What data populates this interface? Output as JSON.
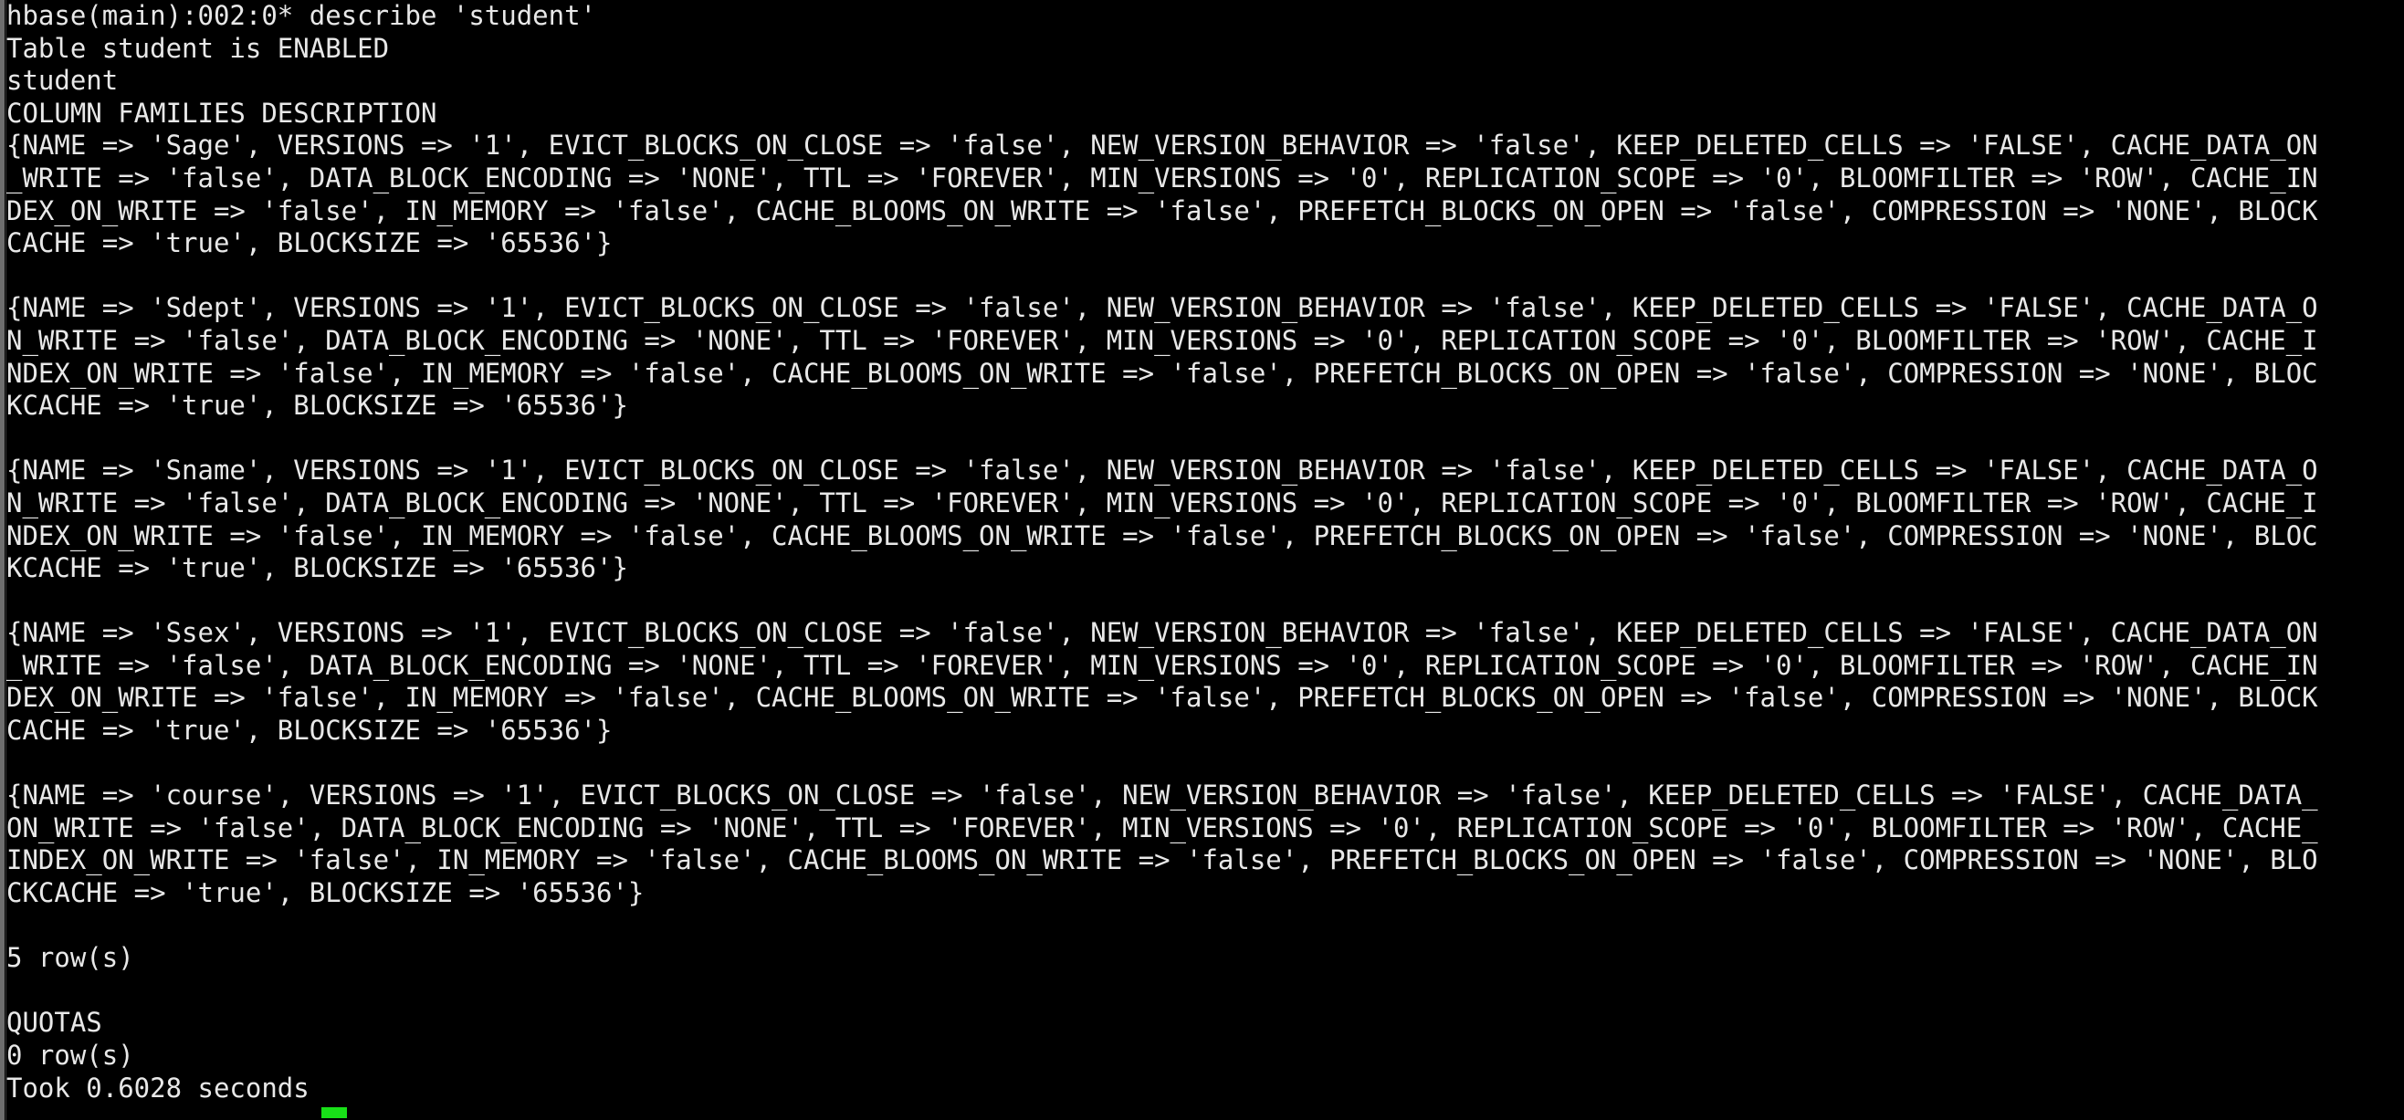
{
  "terminal": {
    "app": "hbase-shell",
    "background_color": "#000000",
    "foreground_color": "#e8e8e8",
    "cursor_color": "#18e018",
    "scrollbar_color": "#6e6e6e",
    "prompt": "hbase(main):002:0*",
    "command": "describe 'student'",
    "lines": [
      "hbase(main):002:0* describe 'student'",
      "Table student is ENABLED",
      "student",
      "COLUMN FAMILIES DESCRIPTION",
      "{NAME => 'Sage', VERSIONS => '1', EVICT_BLOCKS_ON_CLOSE => 'false', NEW_VERSION_BEHAVIOR => 'false', KEEP_DELETED_CELLS => 'FALSE', CACHE_DATA_ON",
      "_WRITE => 'false', DATA_BLOCK_ENCODING => 'NONE', TTL => 'FOREVER', MIN_VERSIONS => '0', REPLICATION_SCOPE => '0', BLOOMFILTER => 'ROW', CACHE_IN",
      "DEX_ON_WRITE => 'false', IN_MEMORY => 'false', CACHE_BLOOMS_ON_WRITE => 'false', PREFETCH_BLOCKS_ON_OPEN => 'false', COMPRESSION => 'NONE', BLOCK",
      "CACHE => 'true', BLOCKSIZE => '65536'}",
      "",
      "{NAME => 'Sdept', VERSIONS => '1', EVICT_BLOCKS_ON_CLOSE => 'false', NEW_VERSION_BEHAVIOR => 'false', KEEP_DELETED_CELLS => 'FALSE', CACHE_DATA_O",
      "N_WRITE => 'false', DATA_BLOCK_ENCODING => 'NONE', TTL => 'FOREVER', MIN_VERSIONS => '0', REPLICATION_SCOPE => '0', BLOOMFILTER => 'ROW', CACHE_I",
      "NDEX_ON_WRITE => 'false', IN_MEMORY => 'false', CACHE_BLOOMS_ON_WRITE => 'false', PREFETCH_BLOCKS_ON_OPEN => 'false', COMPRESSION => 'NONE', BLOC",
      "KCACHE => 'true', BLOCKSIZE => '65536'}",
      "",
      "{NAME => 'Sname', VERSIONS => '1', EVICT_BLOCKS_ON_CLOSE => 'false', NEW_VERSION_BEHAVIOR => 'false', KEEP_DELETED_CELLS => 'FALSE', CACHE_DATA_O",
      "N_WRITE => 'false', DATA_BLOCK_ENCODING => 'NONE', TTL => 'FOREVER', MIN_VERSIONS => '0', REPLICATION_SCOPE => '0', BLOOMFILTER => 'ROW', CACHE_I",
      "NDEX_ON_WRITE => 'false', IN_MEMORY => 'false', CACHE_BLOOMS_ON_WRITE => 'false', PREFETCH_BLOCKS_ON_OPEN => 'false', COMPRESSION => 'NONE', BLOC",
      "KCACHE => 'true', BLOCKSIZE => '65536'}",
      "",
      "{NAME => 'Ssex', VERSIONS => '1', EVICT_BLOCKS_ON_CLOSE => 'false', NEW_VERSION_BEHAVIOR => 'false', KEEP_DELETED_CELLS => 'FALSE', CACHE_DATA_ON",
      "_WRITE => 'false', DATA_BLOCK_ENCODING => 'NONE', TTL => 'FOREVER', MIN_VERSIONS => '0', REPLICATION_SCOPE => '0', BLOOMFILTER => 'ROW', CACHE_IN",
      "DEX_ON_WRITE => 'false', IN_MEMORY => 'false', CACHE_BLOOMS_ON_WRITE => 'false', PREFETCH_BLOCKS_ON_OPEN => 'false', COMPRESSION => 'NONE', BLOCK",
      "CACHE => 'true', BLOCKSIZE => '65536'}",
      "",
      "{NAME => 'course', VERSIONS => '1', EVICT_BLOCKS_ON_CLOSE => 'false', NEW_VERSION_BEHAVIOR => 'false', KEEP_DELETED_CELLS => 'FALSE', CACHE_DATA_",
      "ON_WRITE => 'false', DATA_BLOCK_ENCODING => 'NONE', TTL => 'FOREVER', MIN_VERSIONS => '0', REPLICATION_SCOPE => '0', BLOOMFILTER => 'ROW', CACHE_",
      "INDEX_ON_WRITE => 'false', IN_MEMORY => 'false', CACHE_BLOOMS_ON_WRITE => 'false', PREFETCH_BLOCKS_ON_OPEN => 'false', COMPRESSION => 'NONE', BLO",
      "CKCACHE => 'true', BLOCKSIZE => '65536'}",
      "",
      "5 row(s)",
      "",
      "QUOTAS",
      "0 row(s)",
      "Took 0.6028 seconds"
    ],
    "table_name": "student",
    "table_status": "ENABLED",
    "section_headers": [
      "COLUMN FAMILIES DESCRIPTION",
      "QUOTAS"
    ],
    "column_families": [
      {
        "NAME": "Sage",
        "VERSIONS": "1",
        "EVICT_BLOCKS_ON_CLOSE": "false",
        "NEW_VERSION_BEHAVIOR": "false",
        "KEEP_DELETED_CELLS": "FALSE",
        "CACHE_DATA_ON_WRITE": "false",
        "DATA_BLOCK_ENCODING": "NONE",
        "TTL": "FOREVER",
        "MIN_VERSIONS": "0",
        "REPLICATION_SCOPE": "0",
        "BLOOMFILTER": "ROW",
        "CACHE_INDEX_ON_WRITE": "false",
        "IN_MEMORY": "false",
        "CACHE_BLOOMS_ON_WRITE": "false",
        "PREFETCH_BLOCKS_ON_OPEN": "false",
        "COMPRESSION": "NONE",
        "BLOCKCACHE": "true",
        "BLOCKSIZE": "65536"
      },
      {
        "NAME": "Sdept",
        "VERSIONS": "1",
        "EVICT_BLOCKS_ON_CLOSE": "false",
        "NEW_VERSION_BEHAVIOR": "false",
        "KEEP_DELETED_CELLS": "FALSE",
        "CACHE_DATA_ON_WRITE": "false",
        "DATA_BLOCK_ENCODING": "NONE",
        "TTL": "FOREVER",
        "MIN_VERSIONS": "0",
        "REPLICATION_SCOPE": "0",
        "BLOOMFILTER": "ROW",
        "CACHE_INDEX_ON_WRITE": "false",
        "IN_MEMORY": "false",
        "CACHE_BLOOMS_ON_WRITE": "false",
        "PREFETCH_BLOCKS_ON_OPEN": "false",
        "COMPRESSION": "NONE",
        "BLOCKCACHE": "true",
        "BLOCKSIZE": "65536"
      },
      {
        "NAME": "Sname",
        "VERSIONS": "1",
        "EVICT_BLOCKS_ON_CLOSE": "false",
        "NEW_VERSION_BEHAVIOR": "false",
        "KEEP_DELETED_CELLS": "FALSE",
        "CACHE_DATA_ON_WRITE": "false",
        "DATA_BLOCK_ENCODING": "NONE",
        "TTL": "FOREVER",
        "MIN_VERSIONS": "0",
        "REPLICATION_SCOPE": "0",
        "BLOOMFILTER": "ROW",
        "CACHE_INDEX_ON_WRITE": "false",
        "IN_MEMORY": "false",
        "CACHE_BLOOMS_ON_WRITE": "false",
        "PREFETCH_BLOCKS_ON_OPEN": "false",
        "COMPRESSION": "NONE",
        "BLOCKCACHE": "true",
        "BLOCKSIZE": "65536"
      },
      {
        "NAME": "Ssex",
        "VERSIONS": "1",
        "EVICT_BLOCKS_ON_CLOSE": "false",
        "NEW_VERSION_BEHAVIOR": "false",
        "KEEP_DELETED_CELLS": "FALSE",
        "CACHE_DATA_ON_WRITE": "false",
        "DATA_BLOCK_ENCODING": "NONE",
        "TTL": "FOREVER",
        "MIN_VERSIONS": "0",
        "REPLICATION_SCOPE": "0",
        "BLOOMFILTER": "ROW",
        "CACHE_INDEX_ON_WRITE": "false",
        "IN_MEMORY": "false",
        "CACHE_BLOOMS_ON_WRITE": "false",
        "PREFETCH_BLOCKS_ON_OPEN": "false",
        "COMPRESSION": "NONE",
        "BLOCKCACHE": "true",
        "BLOCKSIZE": "65536"
      },
      {
        "NAME": "course",
        "VERSIONS": "1",
        "EVICT_BLOCKS_ON_CLOSE": "false",
        "NEW_VERSION_BEHAVIOR": "false",
        "KEEP_DELETED_CELLS": "FALSE",
        "CACHE_DATA_ON_WRITE": "false",
        "DATA_BLOCK_ENCODING": "NONE",
        "TTL": "FOREVER",
        "MIN_VERSIONS": "0",
        "REPLICATION_SCOPE": "0",
        "BLOOMFILTER": "ROW",
        "CACHE_INDEX_ON_WRITE": "false",
        "IN_MEMORY": "false",
        "CACHE_BLOOMS_ON_WRITE": "false",
        "PREFETCH_BLOCKS_ON_OPEN": "false",
        "COMPRESSION": "NONE",
        "BLOCKCACHE": "true",
        "BLOCKSIZE": "65536"
      }
    ],
    "families_row_count": "5 row(s)",
    "quotas_row_count": "0 row(s)",
    "elapsed": "Took 0.6028 seconds"
  }
}
